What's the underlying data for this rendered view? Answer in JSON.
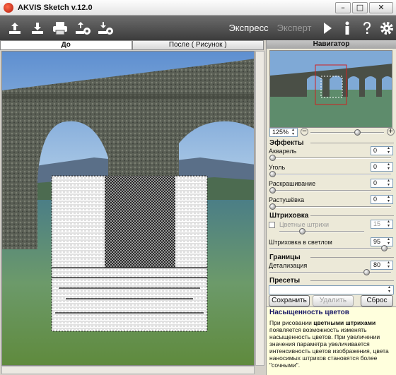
{
  "window": {
    "title": "AKVIS Sketch v.12.0",
    "min": "–",
    "max": "□",
    "close": "✕"
  },
  "toolbar": {
    "icons": [
      "open-icon",
      "save-icon",
      "print-icon",
      "export-settings-icon",
      "import-settings-icon"
    ],
    "mode_express": "Экспресс",
    "mode_expert": "Эксперт",
    "right_icons": [
      "run-icon",
      "info-icon",
      "help-icon",
      "settings-icon"
    ]
  },
  "tabs": {
    "before": "До",
    "after": "После ( Рисунок )"
  },
  "navigator": {
    "title": "Навигатор",
    "zoom": "125%",
    "zoom_level": 0.6
  },
  "effects": {
    "title": "Эффекты",
    "params": [
      {
        "label": "Акварель",
        "value": "0",
        "level": 0
      },
      {
        "label": "Уголь",
        "value": "0",
        "level": 0
      },
      {
        "label": "Раскрашивание",
        "value": "0",
        "level": 0
      },
      {
        "label": "Растушёвка",
        "value": "0",
        "level": 0
      }
    ]
  },
  "hatching": {
    "title": "Штриховка",
    "colored_strokes_label": "Цветные штрихи",
    "colored_strokes_value": "15",
    "colored_strokes_checked": false,
    "colored_strokes_level": 0.25,
    "highlights_label": "Штриховка в светлом",
    "highlights_value": "95",
    "highlights_level": 0.95
  },
  "edges": {
    "title": "Границы",
    "detail_label": "Детализация",
    "detail_value": "80",
    "detail_level": 0.8
  },
  "presets": {
    "title": "Пресеты",
    "selected": "",
    "save": "Сохранить",
    "delete": "Удалить",
    "reset": "Сброс"
  },
  "help": {
    "title": "Насыщенность цветов",
    "p1": "При рисовании",
    "p1_bold": "цветными штрихами",
    "p1_rest": "появляется возможность изменять насыщенность цветов. При увеличении значения параметра увеличивается интенсивность цветов изображения, цвета наносимых штрихов становятся более \"сочными\"."
  },
  "colors": {
    "toolbar_dark": "#3c3c3c",
    "help_bg": "#ffffdd",
    "help_title": "#1a1a66"
  }
}
